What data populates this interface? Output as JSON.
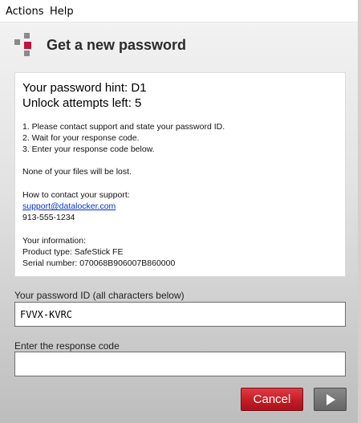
{
  "menu": {
    "actions": "Actions",
    "help": "Help"
  },
  "header": {
    "title": "Get a new password"
  },
  "info": {
    "hint_label": "Your password hint:  D1",
    "attempts_label": "Unlock attempts left:  5",
    "steps": [
      "1. Please contact support and state your password ID.",
      "2. Wait for your response code.",
      "3. Enter your response code below."
    ],
    "files_note": "None of your files will be lost.",
    "contact_heading": "How to contact your support:",
    "support_email": "support@datalocker.com",
    "support_phone": "913-555-1234",
    "your_info_heading": "Your information:",
    "product_type": "Product type: SafeStick FE",
    "serial_number": "Serial number: 070068B906007B860000"
  },
  "password_id": {
    "label": "Your password ID (all characters below)",
    "value": "FVVX-KVRC"
  },
  "response_code": {
    "label": "Enter the response code",
    "value": ""
  },
  "buttons": {
    "cancel": "Cancel"
  },
  "icons": {
    "logo": "datalocker-logo-icon",
    "next": "play-arrow-icon"
  },
  "colors": {
    "cancel_red": "#c41c26",
    "link_blue": "#0033cc",
    "logo_red": "#c4123a"
  }
}
